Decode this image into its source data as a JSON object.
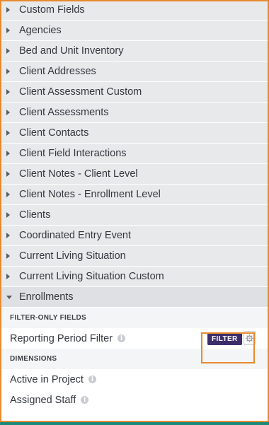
{
  "views": [
    {
      "label": "Custom Fields",
      "expanded": false
    },
    {
      "label": "Agencies",
      "expanded": false
    },
    {
      "label": "Bed and Unit Inventory",
      "expanded": false
    },
    {
      "label": "Client Addresses",
      "expanded": false
    },
    {
      "label": "Client Assessment Custom",
      "expanded": false
    },
    {
      "label": "Client Assessments",
      "expanded": false
    },
    {
      "label": "Client Contacts",
      "expanded": false
    },
    {
      "label": "Client Field Interactions",
      "expanded": false
    },
    {
      "label": "Client Notes - Client Level",
      "expanded": false
    },
    {
      "label": "Client Notes - Enrollment Level",
      "expanded": false
    },
    {
      "label": "Clients",
      "expanded": false
    },
    {
      "label": "Coordinated Entry Event",
      "expanded": false
    },
    {
      "label": "Current Living Situation",
      "expanded": false
    },
    {
      "label": "Current Living Situation Custom",
      "expanded": false
    },
    {
      "label": "Enrollments",
      "expanded": true
    }
  ],
  "enrollments": {
    "filter_only_header": "FILTER-ONLY FIELDS",
    "filter_only_fields": [
      {
        "label": "Reporting Period Filter",
        "filter_button": "FILTER"
      }
    ],
    "dimensions_header": "DIMENSIONS",
    "dimensions": [
      {
        "label": "Active in Project"
      },
      {
        "label": "Assigned Staff"
      }
    ]
  },
  "icons": {
    "collapsed": "caret-right-icon",
    "expanded": "caret-down-icon",
    "info": "info-icon",
    "gear": "gear-icon"
  },
  "colors": {
    "highlight": "#e88a2e",
    "filter_button": "#3d2e6b",
    "bottom_bar": "#1c8a7a"
  }
}
